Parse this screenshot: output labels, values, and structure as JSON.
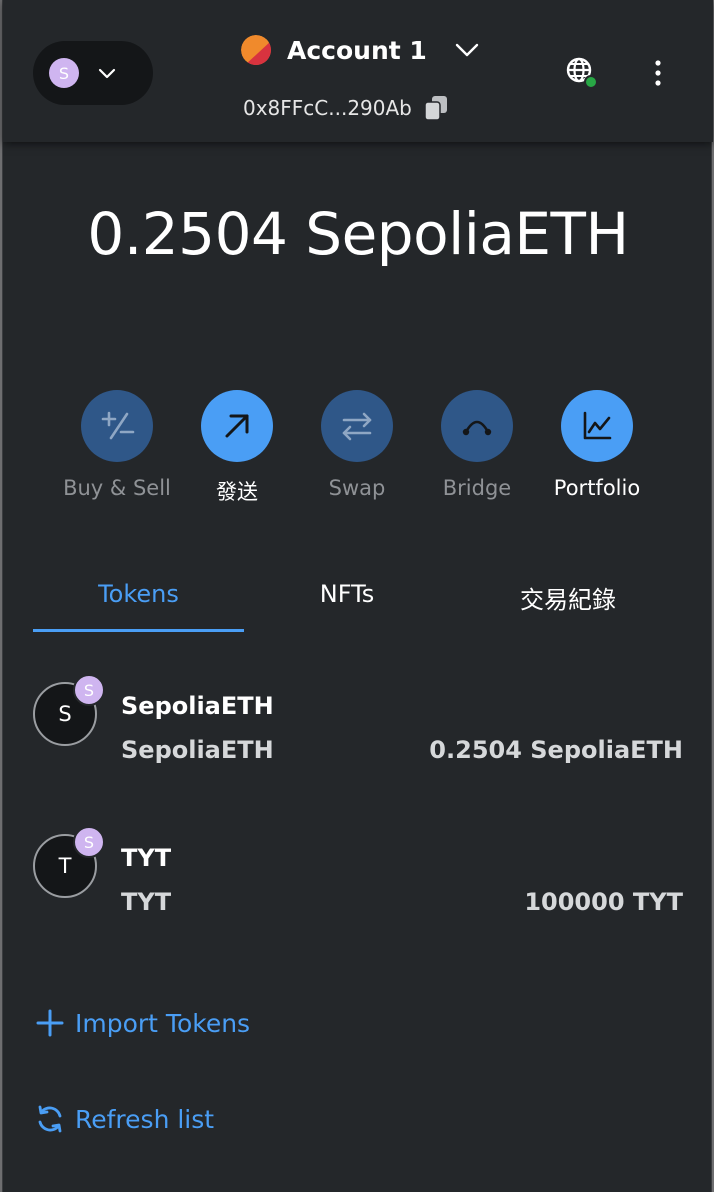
{
  "header": {
    "network_avatar_letter": "S",
    "account_name": "Account 1",
    "address": "0x8FFcC...290Ab"
  },
  "balance": {
    "display": "0.2504 SepoliaETH"
  },
  "actions": [
    {
      "label": "Buy & Sell",
      "icon": "buy-sell-icon",
      "enabled": false
    },
    {
      "label": "發送",
      "icon": "send-arrow-icon",
      "enabled": true
    },
    {
      "label": "Swap",
      "icon": "swap-icon",
      "enabled": false
    },
    {
      "label": "Bridge",
      "icon": "bridge-icon",
      "enabled": false
    },
    {
      "label": "Portfolio",
      "icon": "portfolio-chart-icon",
      "enabled": true
    }
  ],
  "tabs": [
    {
      "label": "Tokens",
      "active": true
    },
    {
      "label": "NFTs",
      "active": false
    },
    {
      "label": "交易紀錄",
      "active": false
    }
  ],
  "tokens": [
    {
      "avatar_letter": "S",
      "badge_letter": "S",
      "name": "SepoliaETH",
      "symbol": "SepoliaETH",
      "amount": "0.2504 SepoliaETH"
    },
    {
      "avatar_letter": "T",
      "badge_letter": "S",
      "name": "TYT",
      "symbol": "TYT",
      "amount": "100000 TYT"
    }
  ],
  "links": {
    "import_tokens": "Import Tokens",
    "refresh_list": "Refresh list"
  },
  "colors": {
    "background": "#24272a",
    "accent": "#4a9ef5",
    "disabled_button": "#2f5788",
    "muted_text": "#8f9296",
    "network_avatar": "#cfb5f0"
  }
}
